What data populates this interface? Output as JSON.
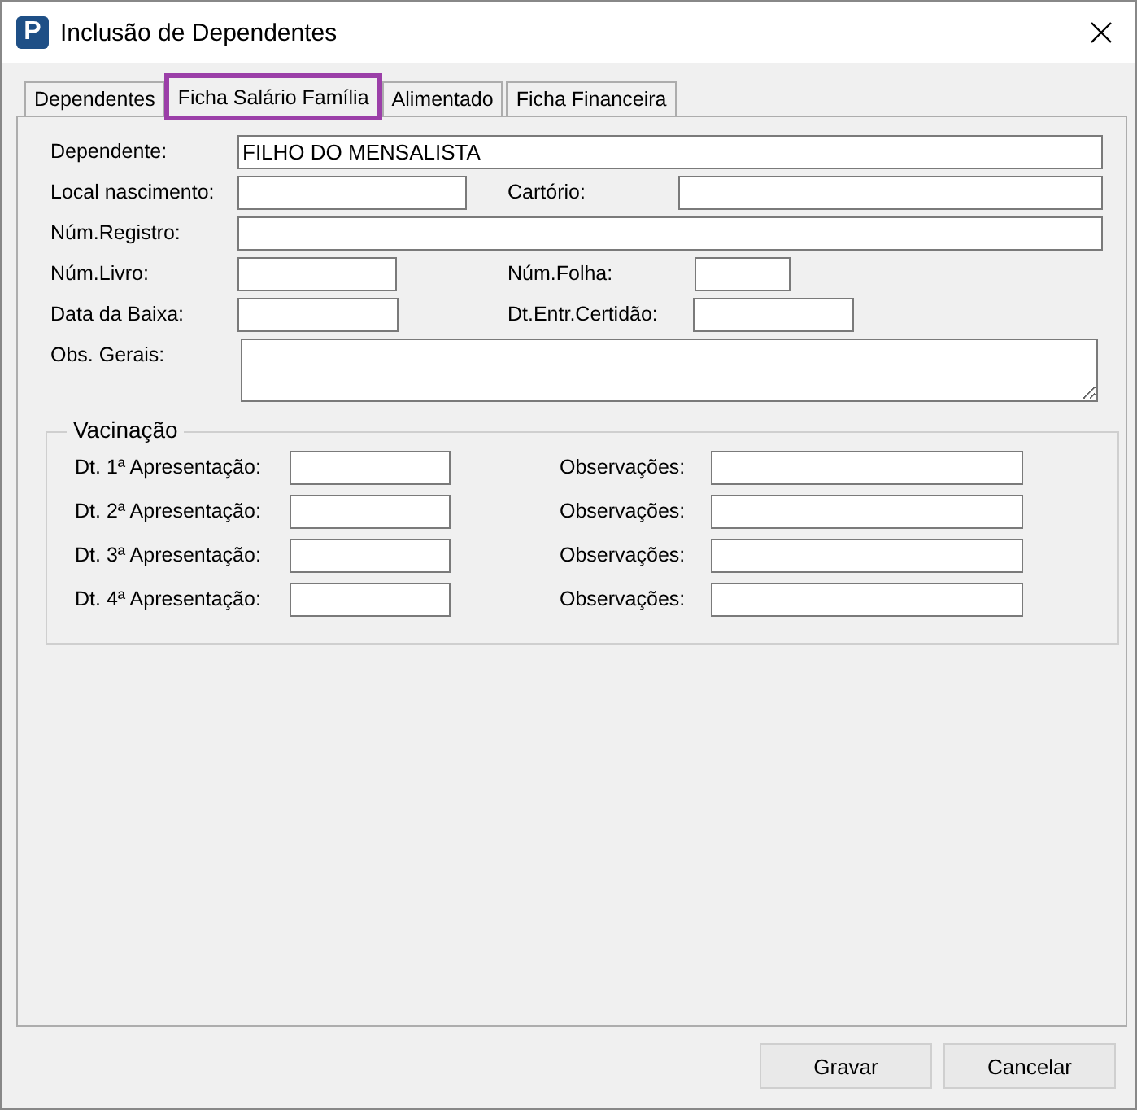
{
  "window": {
    "logo": "P",
    "title": "Inclusão de Dependentes"
  },
  "tabs": [
    {
      "label": "Dependentes",
      "selected": false
    },
    {
      "label": "Ficha Salário Família",
      "selected": true,
      "highlighted": true
    },
    {
      "label": "Alimentado",
      "selected": false
    },
    {
      "label": "Ficha Financeira",
      "selected": false
    }
  ],
  "rows": [
    {
      "fields": [
        {
          "label": "Dependente:",
          "value": "FILHO DO MENSALISTA"
        }
      ]
    },
    {
      "fields": [
        {
          "label": "Local nascimento:"
        },
        {
          "label": "Cartório:"
        }
      ]
    },
    {
      "fields": [
        {
          "label": "Núm.Registro:"
        }
      ]
    },
    {
      "fields": [
        {
          "label": "Núm.Livro:"
        },
        {
          "label": "Núm.Folha:"
        }
      ]
    },
    {
      "fields": [
        {
          "label": "Data da Baixa:"
        },
        {
          "label": "Dt.Entr.Certidão:"
        }
      ]
    },
    {
      "fields": [
        {
          "label": "Obs. Gerais:",
          "kind": "multiline"
        }
      ]
    }
  ],
  "vacinacao": {
    "title": "Vacinação",
    "rows": [
      {
        "date_label": "Dt. 1ª Apresentação:",
        "obs_label": "Observações:"
      },
      {
        "date_label": "Dt. 2ª Apresentação:",
        "obs_label": "Observações:"
      },
      {
        "date_label": "Dt. 3ª Apresentação:",
        "obs_label": "Observações:"
      },
      {
        "date_label": "Dt. 4ª Apresentação:",
        "obs_label": "Observações:"
      }
    ]
  },
  "buttons": [
    "Gravar",
    "Cancelar"
  ]
}
